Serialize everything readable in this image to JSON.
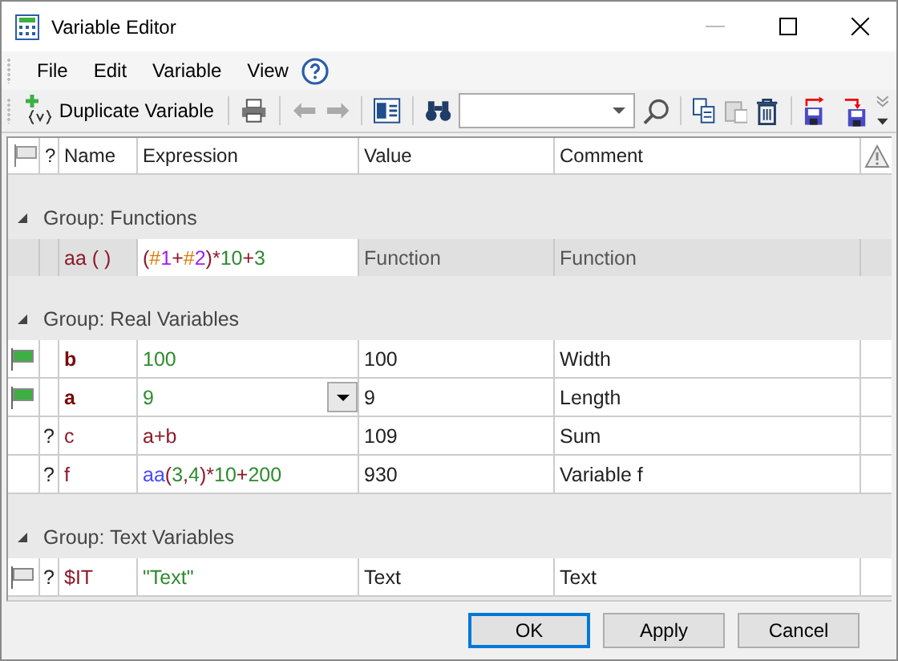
{
  "window": {
    "title": "Variable Editor"
  },
  "menu": [
    {
      "label": "File"
    },
    {
      "label": "Edit"
    },
    {
      "label": "Variable"
    },
    {
      "label": "View"
    }
  ],
  "toolbar": {
    "duplicate_label": "Duplicate Variable"
  },
  "table": {
    "columns": [
      "?",
      "Name",
      "Expression",
      "Value",
      "Comment"
    ],
    "groups": [
      {
        "label": "Group: Functions",
        "expanded": true,
        "rows": [
          {
            "kind": "function",
            "name": "aa ( )",
            "bold": false,
            "expression": [
              {
                "text": "(",
                "color": "#8b1a2a"
              },
              {
                "text": "#",
                "color": "#e07b00"
              },
              {
                "text": "1",
                "color": "#a020f0"
              },
              {
                "text": "+",
                "color": "#8b1a2a"
              },
              {
                "text": "#",
                "color": "#e07b00"
              },
              {
                "text": "2",
                "color": "#a020f0"
              },
              {
                "text": ")*",
                "color": "#8b1a2a"
              },
              {
                "text": "10",
                "color": "#2e8b2e"
              },
              {
                "text": "+",
                "color": "#8b1a2a"
              },
              {
                "text": "3",
                "color": "#2e8b2e"
              }
            ],
            "dropdown": false,
            "value": "Function",
            "comment": "Function"
          }
        ]
      },
      {
        "label": "Group: Real Variables",
        "expanded": true,
        "rows": [
          {
            "kind": "variable",
            "flag": {
              "color": "#3cb043"
            },
            "name": "b",
            "bold": true,
            "expression": [
              {
                "text": "100",
                "color": "#2e8b2e"
              }
            ],
            "dropdown": false,
            "value": "100",
            "comment": "Width"
          },
          {
            "kind": "variable",
            "flag": {
              "color": "#3cb043"
            },
            "name": "a",
            "bold": true,
            "expression": [
              {
                "text": "9",
                "color": "#2e8b2e"
              }
            ],
            "dropdown": true,
            "value": "9",
            "comment": "Length"
          },
          {
            "kind": "variable",
            "status": "?",
            "name": "c",
            "bold": false,
            "expression": [
              {
                "text": "a+b",
                "color": "#8b1a2a"
              }
            ],
            "dropdown": false,
            "value": "109",
            "comment": "Sum"
          },
          {
            "kind": "variable",
            "status": "?",
            "name": "f",
            "bold": false,
            "expression": [
              {
                "text": "aa",
                "color": "#4a4aff"
              },
              {
                "text": "(",
                "color": "#8b1a2a"
              },
              {
                "text": "3",
                "color": "#2e8b2e"
              },
              {
                "text": ",",
                "color": "#8b1a2a"
              },
              {
                "text": "4",
                "color": "#2e8b2e"
              },
              {
                "text": ")*",
                "color": "#8b1a2a"
              },
              {
                "text": "10",
                "color": "#2e8b2e"
              },
              {
                "text": "+",
                "color": "#8b1a2a"
              },
              {
                "text": "200",
                "color": "#2e8b2e"
              }
            ],
            "dropdown": false,
            "value": "930",
            "comment": "Variable f"
          }
        ]
      },
      {
        "label": "Group: Text Variables",
        "expanded": true,
        "rows": [
          {
            "kind": "variable",
            "flag": {
              "color": "#e6e6e6"
            },
            "status": "?",
            "name": "$IT",
            "bold": false,
            "expression": [
              {
                "text": "\"Text\"",
                "color": "#2e8b2e"
              }
            ],
            "dropdown": false,
            "value": "Text",
            "comment": "Text"
          }
        ]
      }
    ]
  },
  "buttons": [
    {
      "label": "OK",
      "default": true
    },
    {
      "label": "Apply",
      "default": false
    },
    {
      "label": "Cancel",
      "default": false
    }
  ]
}
